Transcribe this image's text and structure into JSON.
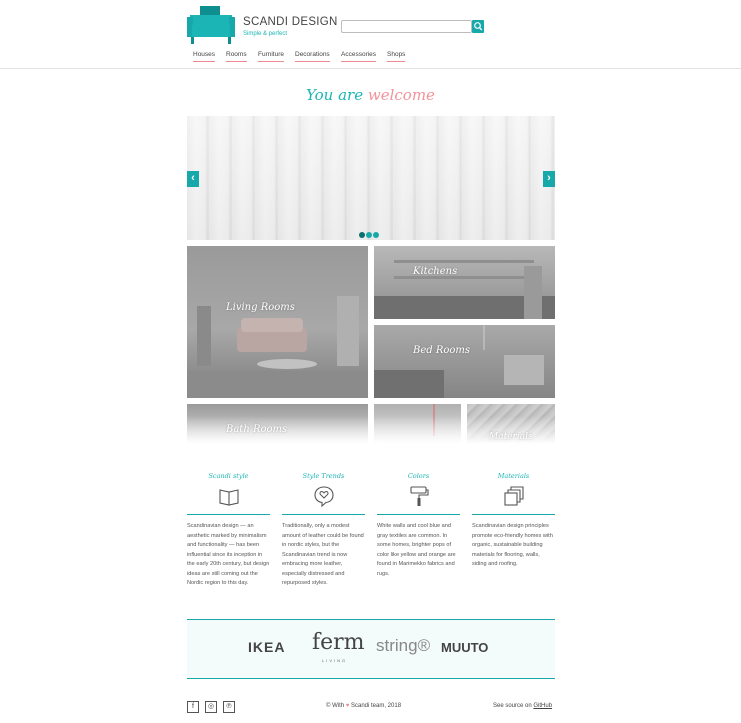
{
  "header": {
    "brand_title": "SCANDI DESIGN",
    "brand_tagline": "Simple & perfect",
    "search": {
      "value": "",
      "placeholder": ""
    },
    "nav": [
      "Houses",
      "Rooms",
      "Furniture",
      "Decorations",
      "Accessories",
      "Shops"
    ]
  },
  "welcome": {
    "part1": "You are",
    "part2": "welcome"
  },
  "slider": {
    "prev_icon": "chevron-left-icon",
    "next_icon": "chevron-right-icon",
    "slide_count": 3,
    "active_slide": 1
  },
  "tiles": {
    "living": "Living Rooms",
    "kitchens": "Kitchens",
    "bed": "Bed Rooms",
    "bath": "Bath Rooms",
    "materials": "Materials"
  },
  "features": [
    {
      "title": "Scandi style",
      "icon": "book-icon",
      "text": "Scandinavian design — an aesthetic marked by minimalism and functionality — has been influential since its inception in the early 20th century, but design ideas are still coming out the Nordic region to this day."
    },
    {
      "title": "Style Trends",
      "icon": "heart-bubble-icon",
      "text": "Traditionally, only a modest amount of leather could be found in nordic styles, but the Scandinavian trend is now embracing more leather, especially distressed and repurposed styles."
    },
    {
      "title": "Colors",
      "icon": "paint-roller-icon",
      "text": "White walls and cool blue and gray textiles are common. In some homes, brighter pops of color like yellow and orange are found in Marimekko fabrics and rugs."
    },
    {
      "title": "Materials",
      "icon": "layers-icon",
      "text": "Scandinavian design principles promote eco-friendly homes with organic, sustainable building materials for flooring, walls, siding and roofing."
    }
  ],
  "brands": {
    "ikea": "IKEA",
    "ferm": "ferm",
    "ferm_sub": "LIVING",
    "string": "string®",
    "muuto": "MUUTO"
  },
  "footer": {
    "social": [
      "facebook-icon",
      "instagram-icon",
      "pinterest-icon"
    ],
    "social_glyphs": [
      "f",
      "◎",
      "℗"
    ],
    "with": "© With",
    "heart": "♥",
    "team": "Scandi team, 2018",
    "source": "See source on",
    "github": "GitHub"
  },
  "colors": {
    "accent": "#17a9a9",
    "pink": "#f2929a"
  }
}
